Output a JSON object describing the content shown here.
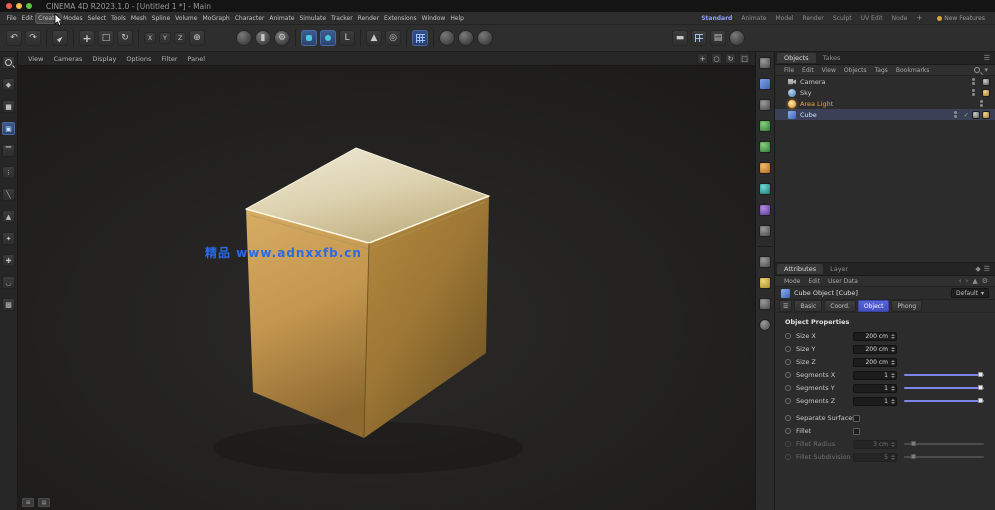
{
  "window": {
    "title": "CINEMA 4D R2023.1.0 - [Untitled 1 *] - Main"
  },
  "menu_bar": {
    "menus": [
      "File",
      "Edit",
      "Create",
      "Modes",
      "Select",
      "Tools",
      "Mesh",
      "Spline",
      "Volume",
      "MoGraph",
      "Character",
      "Animate",
      "Simulate",
      "Tracker",
      "Render",
      "Extensions",
      "Window",
      "Help"
    ],
    "hovered_menu": "Create",
    "layout_tabs": [
      "Standard",
      "Animate",
      "Model",
      "Render",
      "Sculpt",
      "UV Edit",
      "Node"
    ],
    "active_layout_tab": "Standard",
    "add_layout_label": "+",
    "new_features_label": "New Features"
  },
  "toolbar": {
    "axis_x": "X",
    "axis_y": "Y",
    "axis_z": "Z",
    "axis_lock": "L"
  },
  "viewport": {
    "menus": [
      "View",
      "Cameras",
      "Display",
      "Options",
      "Filter",
      "Panel"
    ],
    "watermark": "精品 www.adnxxfb.cn"
  },
  "object_manager": {
    "tabs": [
      "Objects",
      "Takes"
    ],
    "menus": [
      "File",
      "Edit",
      "View",
      "Objects",
      "Tags",
      "Bookmarks"
    ],
    "items": [
      {
        "name": "Camera"
      },
      {
        "name": "Sky"
      },
      {
        "name": "Area Light"
      },
      {
        "name": "Cube"
      }
    ]
  },
  "attributes": {
    "tabs": [
      "Attributes",
      "Layer"
    ],
    "menus": [
      "Mode",
      "Edit",
      "User Data"
    ],
    "object_title": "Cube Object [Cube]",
    "preset_label": "Default",
    "section_tabs": [
      "Basic",
      "Coord.",
      "Object",
      "Phong"
    ],
    "active_section_tab": "Object",
    "section_title": "Object Properties",
    "properties": [
      {
        "label": "Size X",
        "value": "200 cm"
      },
      {
        "label": "Size Y",
        "value": "200 cm"
      },
      {
        "label": "Size Z",
        "value": "200 cm"
      },
      {
        "label": "Segments X",
        "value": "1"
      },
      {
        "label": "Segments Y",
        "value": "1"
      },
      {
        "label": "Segments Z",
        "value": "1"
      },
      {
        "label": "Separate Surfaces",
        "value": ""
      },
      {
        "label": "Fillet",
        "value": ""
      },
      {
        "label": "Fillet Radius",
        "value": "3 cm"
      },
      {
        "label": "Fillet Subdivision",
        "value": "5"
      }
    ]
  },
  "colors": {
    "accent_blue": "#5864d8",
    "slider_purple": "#7b86e8",
    "selected_orange": "#e2a84c",
    "gold_light": "#efe9d8",
    "gold_mid": "#c3964e",
    "gold_dark": "#6e5323",
    "watermark_blue": "#2a6ae8"
  }
}
